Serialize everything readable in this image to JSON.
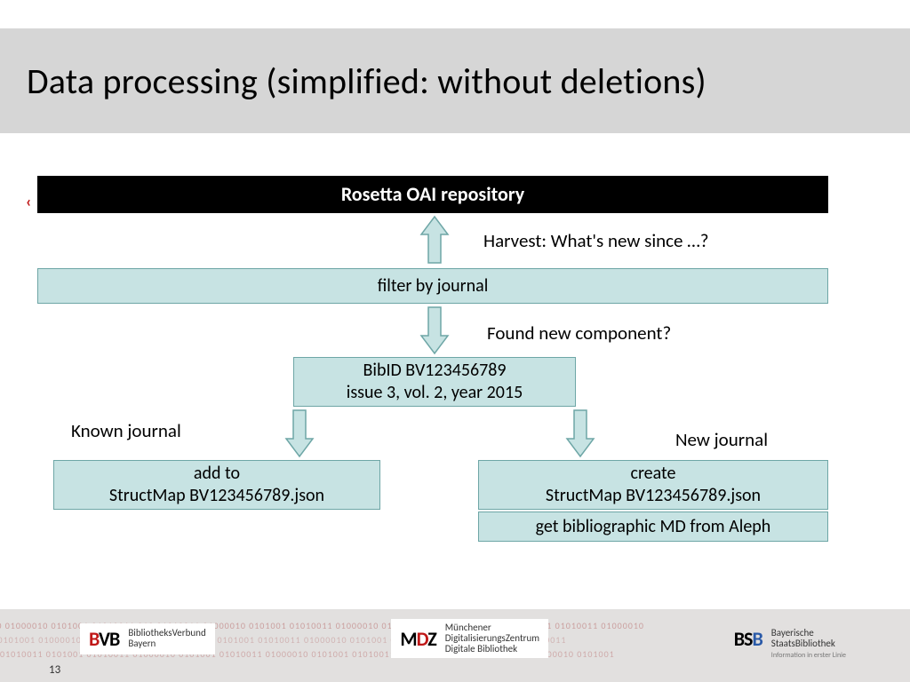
{
  "title": "Data processing (simplified: without deletions)",
  "boxes": {
    "rosetta": "Rosetta OAI repository",
    "filter": "filter by journal",
    "bibid_l1": "BibID BV123456789",
    "bibid_l2": "issue 3, vol. 2, year 2015",
    "add_l1": "add to",
    "add_l2": "StructMap BV123456789.json",
    "create_l1": "create",
    "create_l2": "StructMap BV123456789.json",
    "aleph": "get bibliographic MD from Aleph"
  },
  "labels": {
    "harvest": "Harvest: What's new since …?",
    "found": "Found new component?",
    "known": "Known journal",
    "newj": "New journal"
  },
  "footer": {
    "page": "13",
    "bvb_mark": "BVB",
    "bvb_sub": "BibliotheksVerbund\nBayern",
    "mdz_mark": "MDZ",
    "mdz_sub": "Münchener\nDigitalisierungsZentrum\nDigitale Bibliothek",
    "bsb_mark": "BSB",
    "bsb_sub": "Bayerische\nStaatsBibliothek",
    "bsb_tag": "Information in erster Linie"
  },
  "chart_data": {
    "type": "flowchart",
    "title": "Data processing (simplified: without deletions)",
    "nodes": [
      {
        "id": "rosetta",
        "label": "Rosetta OAI repository",
        "style": "black"
      },
      {
        "id": "filter",
        "label": "filter by journal"
      },
      {
        "id": "bibid",
        "label": "BibID BV123456789\nissue 3, vol. 2, year 2015"
      },
      {
        "id": "add",
        "label": "add to\nStructMap BV123456789.json"
      },
      {
        "id": "create",
        "label": "create\nStructMap BV123456789.json"
      },
      {
        "id": "aleph",
        "label": "get bibliographic MD from Aleph"
      }
    ],
    "edges": [
      {
        "from": "filter",
        "to": "rosetta",
        "label": "Harvest: What's new since …?",
        "direction": "up"
      },
      {
        "from": "filter",
        "to": "bibid",
        "label": "Found new component?",
        "direction": "down"
      },
      {
        "from": "bibid",
        "to": "add",
        "label": "Known journal",
        "direction": "down-left"
      },
      {
        "from": "bibid",
        "to": "create",
        "label": "New journal",
        "direction": "down-right"
      },
      {
        "from": "create",
        "to": "aleph",
        "direction": "adjacent"
      }
    ]
  }
}
